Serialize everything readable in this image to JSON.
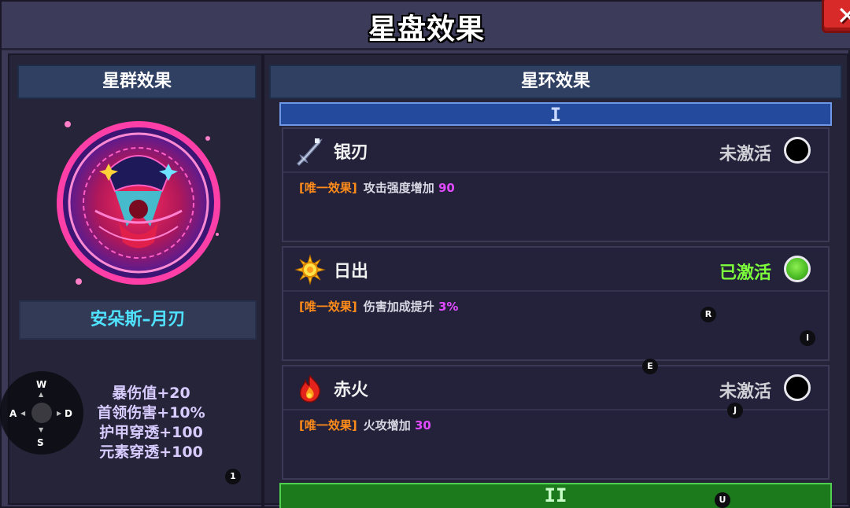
{
  "window": {
    "title": "星盘效果",
    "close_label": "✕"
  },
  "left_panel": {
    "header": "星群效果",
    "constellation_name": "安朵斯–月刃",
    "stats": [
      "暴伤值+20",
      "首领伤害+10%",
      "护甲穿透+100",
      "元素穿透+100"
    ]
  },
  "right_panel": {
    "header": "星环效果",
    "tiers": [
      {
        "label": "I",
        "effects": [
          {
            "name": "银刃",
            "icon": "sword-icon",
            "status": "未激活",
            "active": false,
            "tag": "[唯一效果]",
            "desc": "攻击强度增加",
            "value": "90"
          },
          {
            "name": "日出",
            "icon": "sun-icon",
            "status": "已激活",
            "active": true,
            "tag": "[唯一效果]",
            "desc": "伤害加成提升",
            "value": "3%"
          },
          {
            "name": "赤火",
            "icon": "fire-icon",
            "status": "未激活",
            "active": false,
            "tag": "[唯一效果]",
            "desc": "火攻增加",
            "value": "30"
          }
        ]
      },
      {
        "label": "II",
        "effects": []
      }
    ]
  },
  "joystick": {
    "up": "W",
    "down": "S",
    "left": "A",
    "right": "D"
  },
  "key_hints": [
    "R",
    "I",
    "E",
    "J",
    "1",
    "U"
  ],
  "colors": {
    "active_green": "#7dff3c",
    "effect_tag_orange": "#ff8c1a",
    "effect_value_magenta": "#e14bff",
    "name_cyan": "#4fe3ff",
    "tier1_blue": "#234a9c",
    "tier2_green": "#1c7a1c"
  }
}
